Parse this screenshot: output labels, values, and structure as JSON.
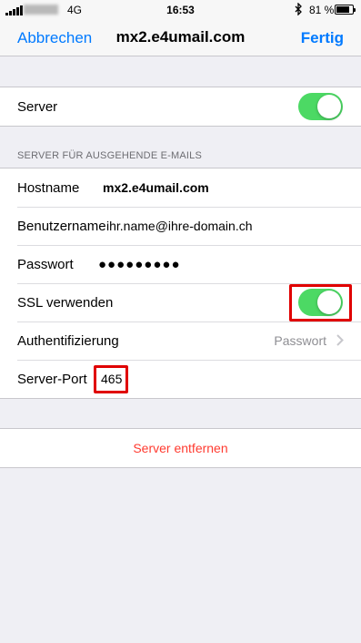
{
  "status_bar": {
    "network": "4G",
    "time": "16:53",
    "battery": "81 %",
    "battery_level": 0.81
  },
  "nav": {
    "cancel": "Abbrechen",
    "title": "mx2.e4umail.com",
    "done": "Fertig"
  },
  "server_toggle": {
    "label": "Server",
    "on": true
  },
  "outgoing": {
    "header": "SERVER FÜR AUSGEHENDE E-MAILS",
    "hostname_label": "Hostname",
    "hostname_value": "mx2.e4umail.com",
    "username_label": "Benutzername",
    "username_value": "ihr.name@ihre-domain.ch",
    "password_label": "Passwort",
    "password_value": "●●●●●●●●●",
    "ssl_label": "SSL verwenden",
    "ssl_on": true,
    "auth_label": "Authentifizierung",
    "auth_value": "Passwort",
    "port_label": "Server-Port",
    "port_value": "465"
  },
  "remove_server": "Server entfernen",
  "colors": {
    "accent": "#007aff",
    "toggle_on": "#4cd964",
    "destructive": "#ff3b30",
    "highlight": "#e00000"
  }
}
